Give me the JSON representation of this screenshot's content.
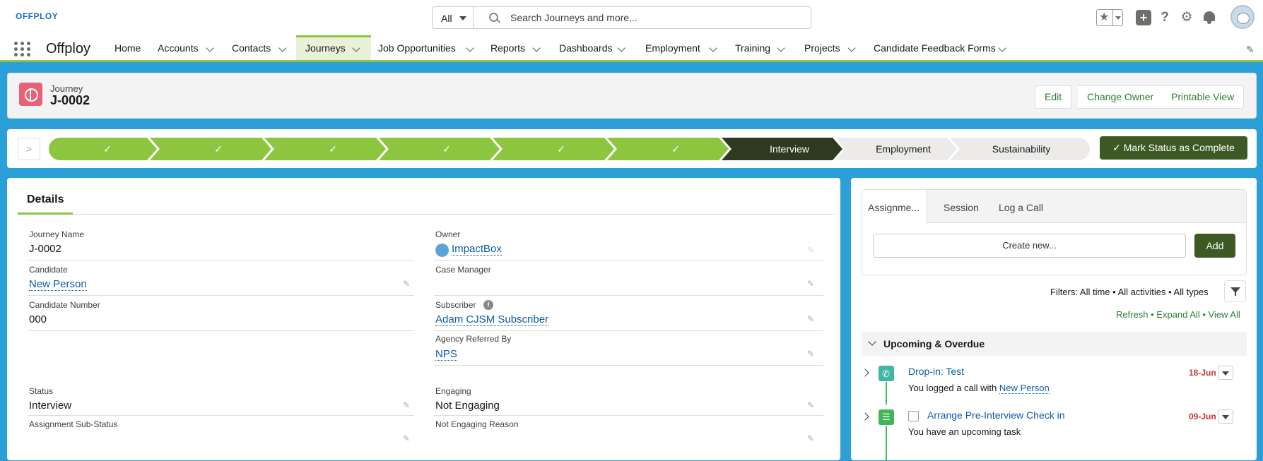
{
  "topbar": {
    "logo": "OFFPLOY",
    "search_scope": "All",
    "search_placeholder": "Search Journeys and more..."
  },
  "nav": {
    "app_name": "Offploy",
    "items": [
      "Home",
      "Accounts",
      "Contacts",
      "Journeys",
      "Job Opportunities",
      "Reports",
      "Dashboards",
      "Employment",
      "Training",
      "Projects",
      "Candidate Feedback Forms"
    ],
    "active": "Journeys"
  },
  "header": {
    "object_label": "Journey",
    "record_name": "J-0002",
    "buttons": [
      "Edit",
      "Change Owner",
      "Printable View"
    ]
  },
  "path": {
    "completed_stage_count": 6,
    "completed_mark": "✓",
    "current": "Interview",
    "upcoming": [
      "Employment",
      "Sustainability"
    ],
    "mark_complete_label": "Mark Status as Complete"
  },
  "details": {
    "tab": "Details",
    "journey_name_label": "Journey Name",
    "journey_name": "J-0002",
    "owner_label": "Owner",
    "owner": "ImpactBox",
    "candidate_label": "Candidate",
    "candidate": "New Person",
    "case_manager_label": "Case Manager",
    "candidate_number_label": "Candidate Number",
    "candidate_number": "000",
    "subscriber_label": "Subscriber",
    "subscriber": "Adam CJSM Subscriber",
    "agency_label": "Agency Referred By",
    "agency": "NPS",
    "status_label": "Status",
    "status": "Interview",
    "engaging_label": "Engaging",
    "engaging": "Not Engaging",
    "sub_status_label": "Assignment Sub-Status",
    "not_engaging_reason_label": "Not Engaging Reason"
  },
  "activity": {
    "tabs": [
      "Assignme...",
      "Session",
      "Log a Call"
    ],
    "create_new": "Create new...",
    "add": "Add",
    "filters": "Filters: All time • All activities • All types",
    "links": "Refresh • Expand All • View All",
    "section": "Upcoming & Overdue",
    "items": [
      {
        "title": "Drop-in: Test",
        "date": "18-Jun",
        "sub_prefix": "You logged a call with",
        "sub_link": "New Person",
        "icon": "phone-icon",
        "color": "#41b6a6"
      },
      {
        "title": "Arrange Pre-Interview Check in",
        "date": "09-Jun",
        "sub_prefix": "You have an upcoming task",
        "sub_link": "",
        "icon": "task-icon",
        "color": "#41b658"
      }
    ]
  },
  "colors": {
    "accent": "#8cc63f",
    "dark_green": "#3d5a24",
    "brand_blue": "#2a9fd8",
    "link": "#0b5cab",
    "overdue": "#c23934"
  }
}
